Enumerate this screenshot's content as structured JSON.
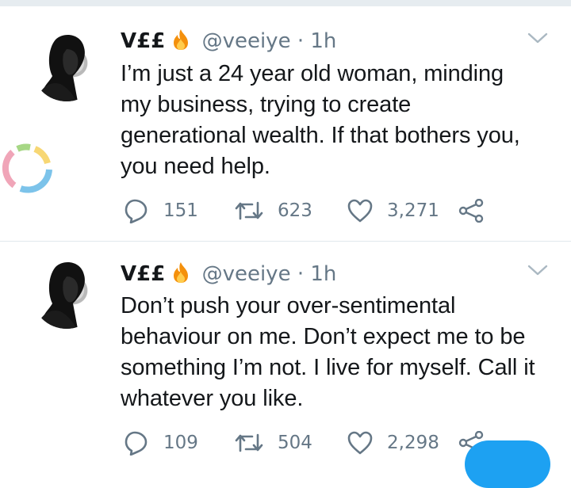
{
  "tweets": [
    {
      "name": "V££",
      "handle": "@veeiye",
      "separator": "·",
      "time": "1h",
      "lines": [
        "I’m just a 24 year old woman, minding",
        "my business, trying to create",
        "generational wealth. If that bothers you,",
        "you need help."
      ],
      "reply_count": "151",
      "retweet_count": "623",
      "like_count": "3,271"
    },
    {
      "name": "V££",
      "handle": "@veeiye",
      "separator": "·",
      "time": "1h",
      "lines": [
        "Don’t push your over-sentimental",
        "behaviour on me. Don’t expect me to be",
        "something I’m not. I live for myself. Call it",
        "whatever you like."
      ],
      "reply_count": "109",
      "retweet_count": "504",
      "like_count": "2,298"
    }
  ],
  "icons": {
    "name_emoji": "fire-icon",
    "menu": "chevron-down-icon",
    "reply": "reply-icon",
    "retweet": "retweet-icon",
    "like": "heart-icon",
    "share": "share-icon"
  },
  "colors": {
    "text": "#14171a",
    "secondary": "#657786",
    "divider": "#e1e8ed",
    "accent": "#1da1f2"
  }
}
